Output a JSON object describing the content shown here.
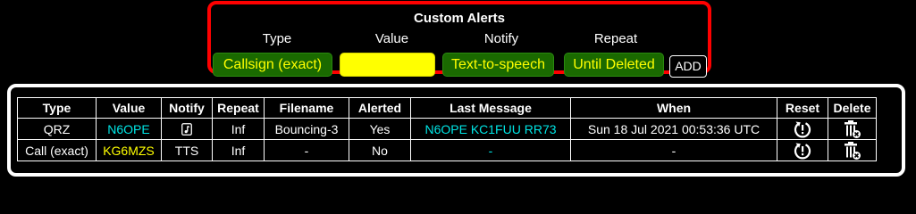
{
  "custom_alerts": {
    "title": "Custom Alerts",
    "labels": {
      "type": "Type",
      "value": "Value",
      "notify": "Notify",
      "repeat": "Repeat"
    },
    "type_select": "Callsign (exact)",
    "value_input": "",
    "notify_select": "Text-to-speech",
    "repeat_select": "Until Deleted",
    "add_label": "ADD"
  },
  "table": {
    "headers": [
      "Type",
      "Value",
      "Notify",
      "Repeat",
      "Filename",
      "Alerted",
      "Last Message",
      "When",
      "Reset",
      "Delete"
    ],
    "rows": [
      {
        "type": "QRZ",
        "value": "N6OPE",
        "notify_icon": "music-note-icon",
        "repeat": "Inf",
        "filename": "Bouncing-3",
        "alerted": "Yes",
        "last_message": "N6OPE KC1FUU RR73",
        "when": "Sun 18 Jul 2021 00:53:36 UTC"
      },
      {
        "type": "Call (exact)",
        "value": "KG6MZS",
        "notify": "TTS",
        "repeat": "Inf",
        "filename": "-",
        "alerted": "No",
        "last_message": "-",
        "when": "-"
      }
    ]
  },
  "colors": {
    "panel_border_red": "#ff0000",
    "pill_green": "#1a6a00",
    "pill_text_yellow": "#ffff00",
    "callsign_cyan": "#00e5e5",
    "callsign_yellow": "#ffff00"
  }
}
